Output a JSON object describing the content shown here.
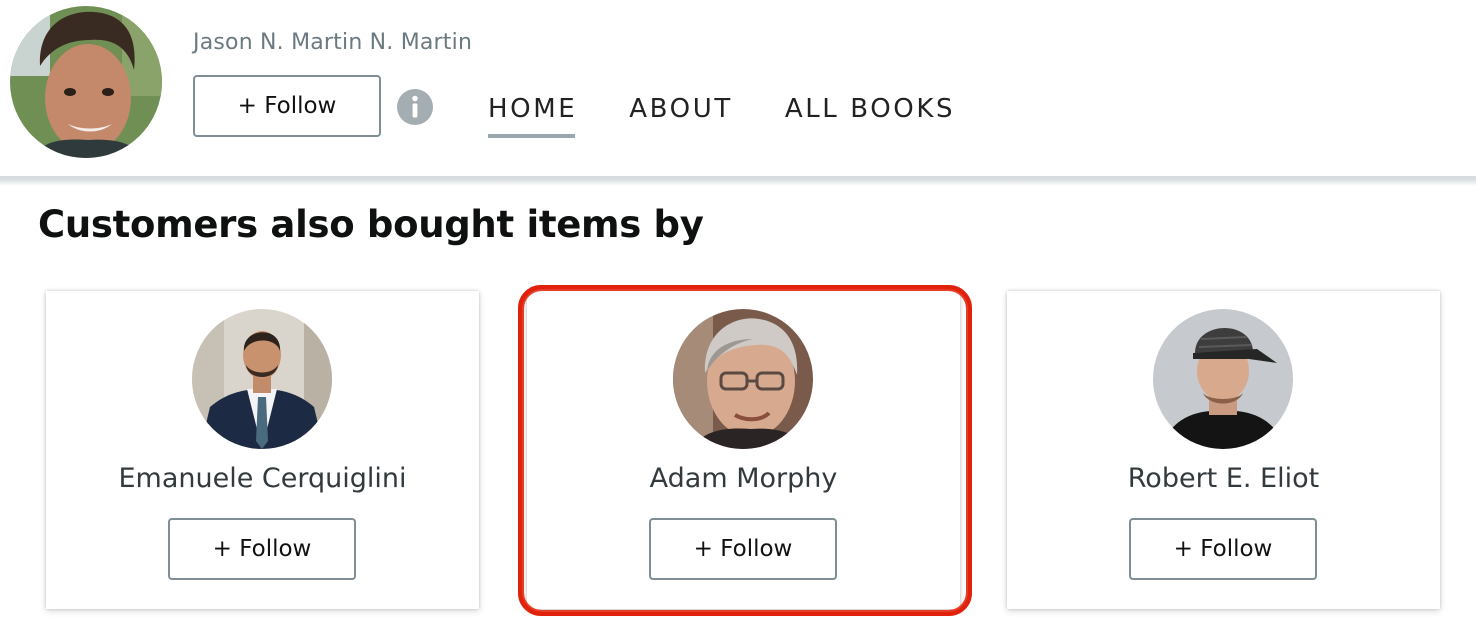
{
  "header": {
    "author_name": "Jason N. Martin N. Martin",
    "follow_label": "+ Follow",
    "info_icon": "info-circle-icon",
    "nav": [
      {
        "label": "HOME",
        "active": true
      },
      {
        "label": "ABOUT",
        "active": false
      },
      {
        "label": "ALL BOOKS",
        "active": false
      }
    ]
  },
  "section": {
    "title": "Customers also bought items by",
    "authors": [
      {
        "name": "Emanuele Cerquiglini",
        "follow_label": "+ Follow"
      },
      {
        "name": "Adam Morphy",
        "follow_label": "+ Follow",
        "highlighted": true
      },
      {
        "name": "Robert E. Eliot",
        "follow_label": "+ Follow"
      }
    ]
  },
  "colors": {
    "highlight": "#e0220c",
    "button_border": "#7f8d94",
    "nav_underline": "#9aa8ae"
  }
}
